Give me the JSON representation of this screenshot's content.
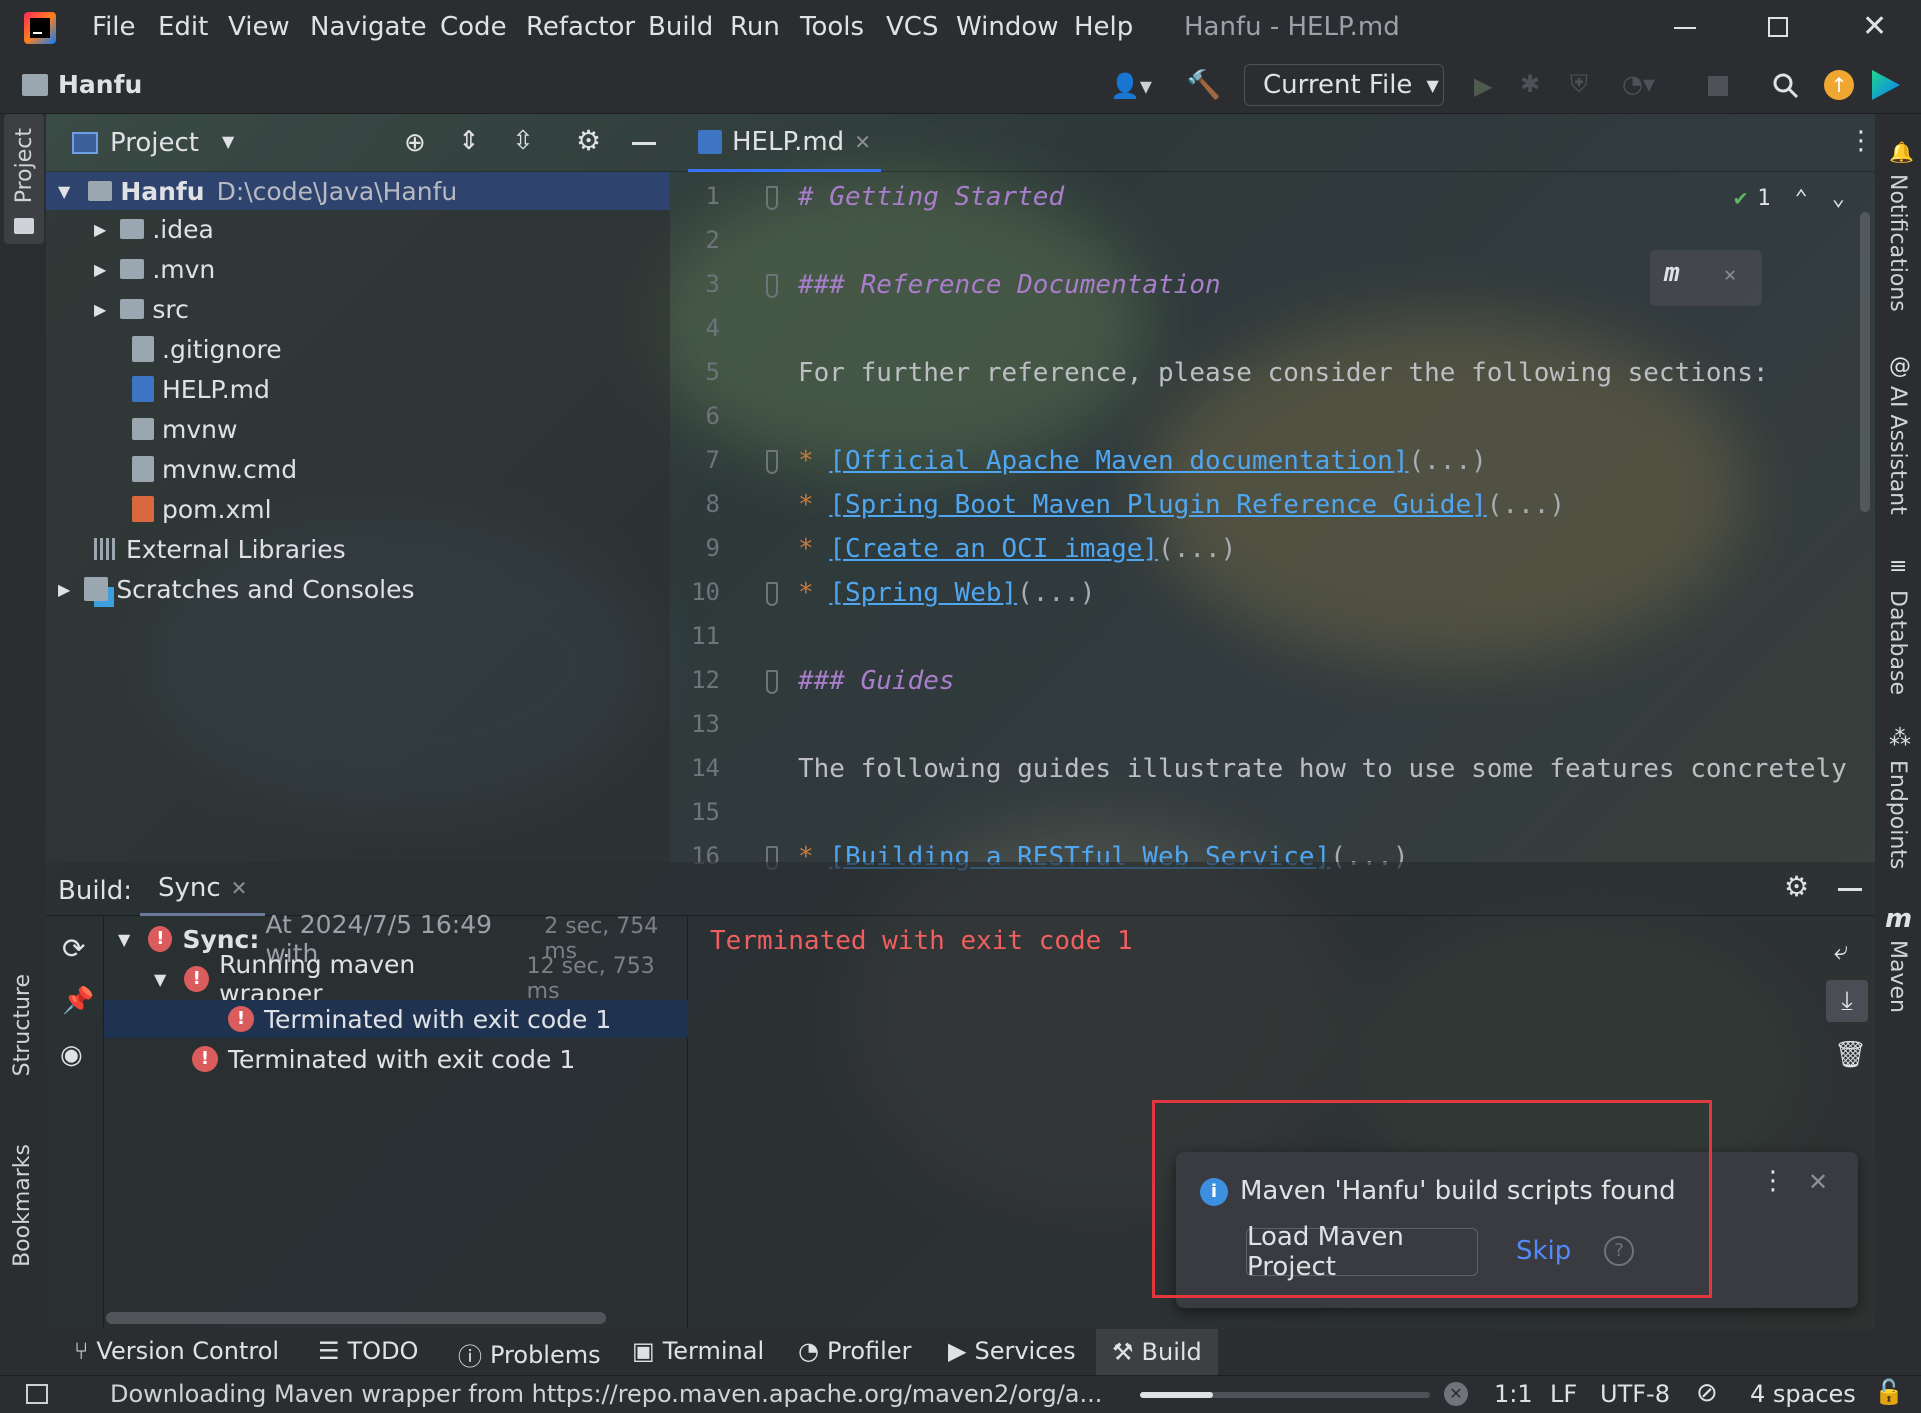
{
  "window": {
    "title": "Hanfu - HELP.md",
    "menu": [
      "File",
      "Edit",
      "View",
      "Navigate",
      "Code",
      "Refactor",
      "Build",
      "Run",
      "Tools",
      "VCS",
      "Window",
      "Help"
    ]
  },
  "toolbar": {
    "project_name": "Hanfu",
    "run_config": "Current File"
  },
  "left_strip": {
    "project": "Project",
    "structure": "Structure",
    "bookmarks": "Bookmarks"
  },
  "right_strip": {
    "notifications": "Notifications",
    "ai": "AI Assistant",
    "database": "Database",
    "endpoints": "Endpoints",
    "maven": "Maven"
  },
  "project_panel": {
    "title": "Project",
    "root": {
      "name": "Hanfu",
      "path": "D:\\code\\Java\\Hanfu"
    },
    "items": [
      ".idea",
      ".mvn",
      "src",
      ".gitignore",
      "HELP.md",
      "mvnw",
      "mvnw.cmd",
      "pom.xml",
      "External Libraries",
      "Scratches and Consoles"
    ]
  },
  "editor": {
    "tab": "HELP.md",
    "inspection_count": "1",
    "lines": [
      {
        "n": "1",
        "text": "# Getting Started"
      },
      {
        "n": "2",
        "text": ""
      },
      {
        "n": "3",
        "text": "### Reference Documentation"
      },
      {
        "n": "4",
        "text": ""
      },
      {
        "n": "5",
        "text": "For further reference, please consider the following sections:"
      },
      {
        "n": "6",
        "text": ""
      },
      {
        "n": "7",
        "text": "[Official Apache Maven documentation]"
      },
      {
        "n": "8",
        "text": "[Spring Boot Maven Plugin Reference Guide]"
      },
      {
        "n": "9",
        "text": "[Create an OCI image]"
      },
      {
        "n": "10",
        "text": "[Spring Web]"
      },
      {
        "n": "11",
        "text": ""
      },
      {
        "n": "12",
        "text": "### Guides"
      },
      {
        "n": "13",
        "text": ""
      },
      {
        "n": "14",
        "text": "The following guides illustrate how to use some features concretely"
      },
      {
        "n": "15",
        "text": ""
      },
      {
        "n": "16",
        "text": "[Building a RESTful Web Service]"
      }
    ],
    "bullet": "*",
    "folded": "(...)"
  },
  "build": {
    "label": "Build:",
    "tab": "Sync",
    "tree": [
      {
        "bold": "Sync:",
        "text": "At 2024/7/5 16:49 with",
        "time": "2 sec, 754 ms"
      },
      {
        "text": "Running maven wrapper",
        "time": "12 sec, 753 ms"
      },
      {
        "text": "Terminated with exit code 1"
      },
      {
        "text": "Terminated with exit code 1"
      }
    ],
    "console": "Terminated with exit code 1"
  },
  "notification": {
    "message": "Maven 'Hanfu' build scripts found",
    "primary": "Load Maven Project",
    "secondary": "Skip"
  },
  "bottom_tabs": [
    "Version Control",
    "TODO",
    "Problems",
    "Terminal",
    "Profiler",
    "Services",
    "Build"
  ],
  "status": {
    "message": "Downloading Maven wrapper from https://repo.maven.apache.org/maven2/org/a...",
    "position": "1:1",
    "line_sep": "LF",
    "encoding": "UTF-8",
    "indent": "4 spaces",
    "progress": 0.25
  }
}
